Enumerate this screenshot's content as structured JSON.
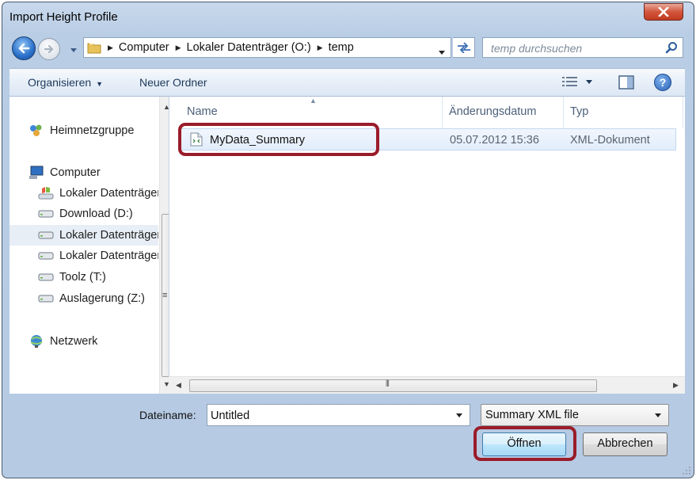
{
  "window": {
    "title": "Import Height Profile"
  },
  "address": {
    "breadcrumbs": [
      "Computer",
      "Lokaler Datenträger (O:)",
      "temp"
    ],
    "search_placeholder": "temp durchsuchen"
  },
  "toolbar": {
    "organize_label": "Organisieren",
    "new_folder_label": "Neuer Ordner"
  },
  "nav": {
    "items": [
      {
        "label": "Heimnetzgruppe",
        "icon": "homegroup-icon"
      },
      {
        "label": "Computer",
        "icon": "computer-icon"
      },
      {
        "label": "Lokaler Datenträger",
        "icon": "system-drive-icon"
      },
      {
        "label": "Download (D:)",
        "icon": "drive-icon"
      },
      {
        "label": "Lokaler Datenträger",
        "icon": "drive-icon",
        "selected": true
      },
      {
        "label": "Lokaler Datenträger",
        "icon": "drive-icon"
      },
      {
        "label": "Toolz (T:)",
        "icon": "drive-icon"
      },
      {
        "label": "Auslagerung (Z:)",
        "icon": "drive-icon"
      },
      {
        "label": "Netzwerk",
        "icon": "network-icon"
      }
    ]
  },
  "columns": {
    "name": "Name",
    "date": "Änderungsdatum",
    "type": "Typ"
  },
  "files": [
    {
      "name": "MyData_Summary",
      "date": "05.07.2012 15:36",
      "type": "XML-Dokument"
    }
  ],
  "bottom": {
    "filename_label": "Dateiname:",
    "filename_value": "Untitled",
    "filter_value": "Summary XML file",
    "open_label": "Öffnen",
    "cancel_label": "Abbrechen"
  },
  "colors": {
    "highlight_box": "#9a1c2a",
    "accent": "#1e395b"
  }
}
